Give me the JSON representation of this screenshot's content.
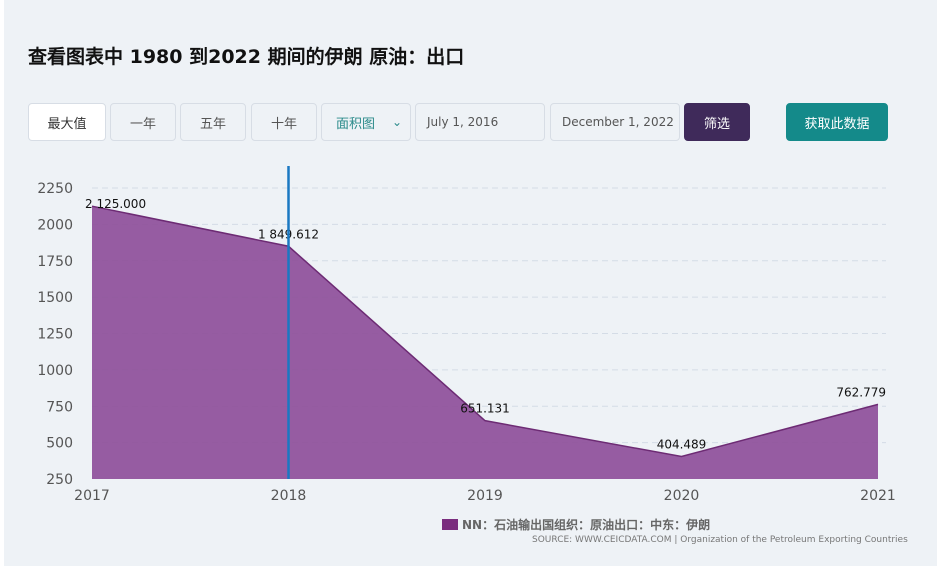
{
  "title": "查看图表中 1980 到2022 期间的伊朗 原油：出口",
  "toolbar": {
    "range_buttons": [
      "最大值",
      "一年",
      "五年",
      "十年"
    ],
    "chart_type": "面积图",
    "start_date": "July 1, 2016",
    "end_date": "December 1, 2022",
    "filter_label": "筛选",
    "get_data_label": "获取此数据"
  },
  "colors": {
    "area": "#8e4f9a",
    "line": "#6d2b74",
    "cursor": "#1a78c2",
    "grid": "#d4dce6",
    "filter_button": "#3f2a5a",
    "get_data_button": "#148a8a"
  },
  "chart_data": {
    "type": "area",
    "x": [
      2017,
      2018,
      2019,
      2020,
      2021
    ],
    "values": [
      2125.0,
      1849.612,
      651.131,
      404.489,
      762.779
    ],
    "data_labels": [
      "2 125.000",
      "1 849.612",
      "651.131",
      "404.489",
      "762.779"
    ],
    "y_ticks": [
      250,
      500,
      750,
      1000,
      1250,
      1500,
      1750,
      2000,
      2250
    ],
    "x_ticks": [
      "2017",
      "2018",
      "2019",
      "2020",
      "2021"
    ],
    "ylim": [
      250,
      2250
    ],
    "grid": true,
    "cursor_x": 2018,
    "legend": "NN：石油输出国组织：原油出口：中东：伊朗",
    "legend_position": "bottom-center",
    "source": "SOURCE: WWW.CEICDATA.COM | Organization of the Petroleum Exporting Countries"
  }
}
